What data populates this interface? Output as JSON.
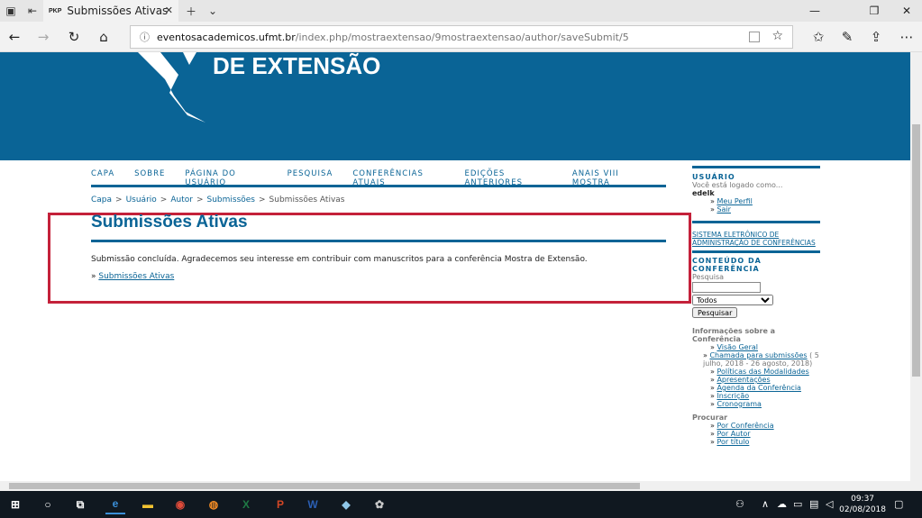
{
  "browser": {
    "tab_title": "Submissões Ativas",
    "tab_favicon_text": "PKP",
    "address_host": "eventosacademicos.ufmt.br",
    "address_path": "/index.php/mostraextensao/9mostraextensao/author/saveSubmit/5"
  },
  "banner": {
    "logo_text": "DE EXTENSÃO"
  },
  "menu": [
    "CAPA",
    "SOBRE",
    "PÁGINA DO USUÁRIO",
    "PESQUISA",
    "CONFERÊNCIAS ATUAIS",
    "EDIÇÕES ANTERIORES",
    "ANAIS VIII MOSTRA"
  ],
  "breadcrumb": [
    "Capa",
    "Usuário",
    "Autor",
    "Submissões",
    "Submissões Ativas"
  ],
  "main": {
    "title": "Submissões Ativas",
    "message": "Submissão concluída. Agradecemos seu interesse em contribuir com manuscritos para a conferência Mostra de Extensão.",
    "link_prefix": "»",
    "link_label": "Submissões Ativas"
  },
  "sidebar": {
    "user_head": "USUÁRIO",
    "logged_as": "Você está logado como...",
    "username": "edelk",
    "user_links": [
      "Meu Perfil",
      "Sair"
    ],
    "system_link": "SISTEMA ELETRÔNICO DE ADMINISTRAÇÃO DE CONFERÊNCIAS",
    "content_head": "CONTEÚDO DA CONFERÊNCIA",
    "search_label": "Pesquisa",
    "search_select": "Todos",
    "search_button": "Pesquisar",
    "info_head": "Informações sobre a Conferência",
    "info_links": [
      "Visão Geral",
      "Chamada para submissões",
      "Políticas das Modalidades",
      "Apresentações",
      "Agenda da Conferência",
      "Inscrição",
      "Cronograma"
    ],
    "call_dates": "( 5 julho, 2018 - 26 agosto, 2018)",
    "browse_head": "Procurar",
    "browse_links": [
      "Por Conferência",
      "Por Autor",
      "Por título"
    ]
  },
  "taskbar": {
    "time": "09:37",
    "date": "02/08/2018"
  },
  "colors": {
    "accent": "#0a6496",
    "highlight": "#c4213a"
  }
}
